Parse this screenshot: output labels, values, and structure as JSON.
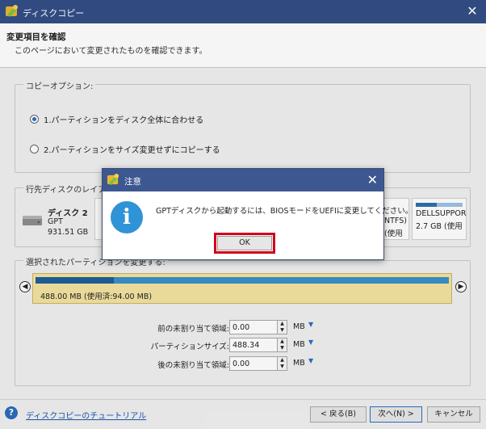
{
  "window": {
    "title": "ディスクコピー",
    "close_glyph": "✕"
  },
  "header": {
    "title": "変更項目を確認",
    "subtitle": "このページにおいて変更されたものを確認できます。"
  },
  "copy_options": {
    "legend": "コピーオプション:",
    "options": [
      {
        "label": "1.パーティションをディスク全体に合わせる",
        "selected": true
      },
      {
        "label": "2.パーティションをサイズ変更せずにコピーする",
        "selected": false
      }
    ]
  },
  "target_layout": {
    "legend": "行先ディスクのレイアウト",
    "disk": {
      "name": "ディスク 2",
      "type": "GPT",
      "size": "931.51 GB"
    },
    "partitions_visible": [
      {
        "label": "NTFS)",
        "detail": "(使用"
      },
      {
        "label": "DELLSUPPOR",
        "detail": "2.7 GB (使用"
      }
    ]
  },
  "selected_partition": {
    "legend": "選択されたパーティションを変更する:",
    "bar_label": "488.00 MB (使用済:94.00 MB)",
    "used_fraction": 0.19,
    "fields": [
      {
        "label": "前の未割り当て領域:",
        "value": "0.00",
        "unit": "MB"
      },
      {
        "label": "パーティションサイズ:",
        "value": "488.34",
        "unit": "MB"
      },
      {
        "label": "後の未割り当て領域:",
        "value": "0.00",
        "unit": "MB"
      }
    ]
  },
  "footer": {
    "help_link": "ディスクコピーのチュートリアル",
    "back": "< 戻る(B)",
    "next": "次へ(N) >",
    "cancel": "キャンセル"
  },
  "dialog": {
    "title": "注意",
    "message": "GPTディスクから起動するには、BIOSモードをUEFIに変更してください。",
    "info_glyph": "i",
    "ok_label": "OK",
    "close_glyph": "✕"
  },
  "colors": {
    "titlebar": "#344f86",
    "dialog_title": "#3d5790",
    "info_icon": "#2f93d8",
    "ok_highlight": "#d3001c",
    "selected_partition_bg": "#f4e3a1"
  }
}
